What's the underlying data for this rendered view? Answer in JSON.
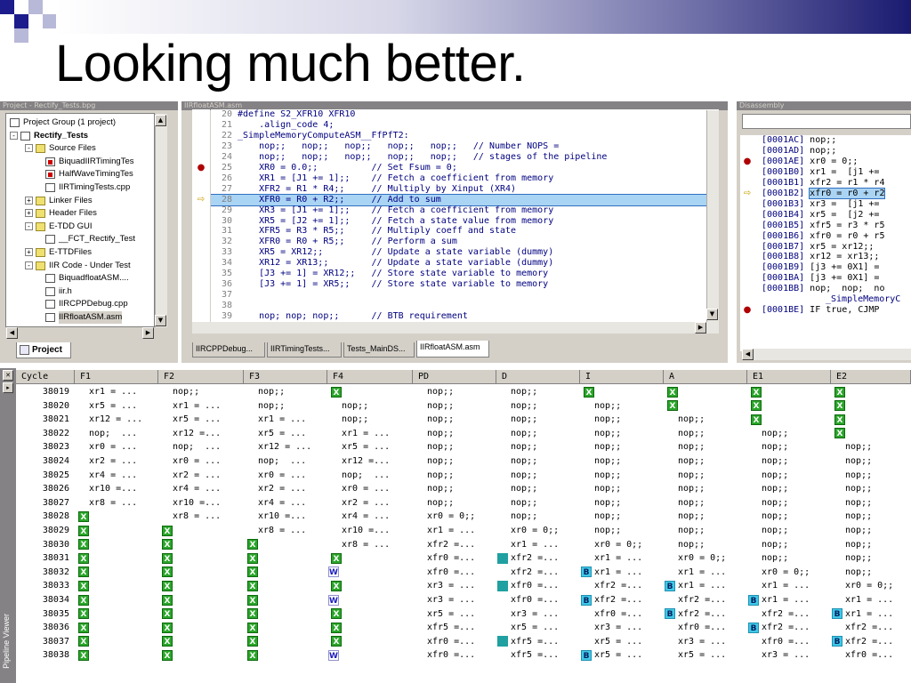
{
  "slide_title": "Looking much better.",
  "project_panel": {
    "title": "Project - Rectify_Tests.bpg",
    "tree": [
      {
        "label": "Project Group (1 project)",
        "indent": 0,
        "icon": "project-group-icon",
        "bold": false,
        "expander": ""
      },
      {
        "label": "Rectify_Tests",
        "indent": 0,
        "icon": "project-icon",
        "bold": true,
        "expander": "-"
      },
      {
        "label": "Source Files",
        "indent": 1,
        "icon": "folder-icon",
        "bold": false,
        "expander": "-"
      },
      {
        "label": "BiquadIIRTimingTes",
        "indent": 2,
        "icon": "excluded-file-icon",
        "bold": false,
        "expander": ""
      },
      {
        "label": "HalfWaveTimingTes",
        "indent": 2,
        "icon": "excluded-file-icon",
        "bold": false,
        "expander": ""
      },
      {
        "label": "IIRTimingTests.cpp",
        "indent": 2,
        "icon": "file-icon",
        "bold": false,
        "expander": ""
      },
      {
        "label": "Linker Files",
        "indent": 1,
        "icon": "folder-icon",
        "bold": false,
        "expander": "+"
      },
      {
        "label": "Header Files",
        "indent": 1,
        "icon": "folder-icon",
        "bold": false,
        "expander": "+"
      },
      {
        "label": "E-TDD GUI",
        "indent": 1,
        "icon": "folder-icon",
        "bold": false,
        "expander": "-"
      },
      {
        "label": "__FCT_Rectify_Test",
        "indent": 2,
        "icon": "file-icon",
        "bold": false,
        "expander": ""
      },
      {
        "label": "E-TTDFiles",
        "indent": 1,
        "icon": "folder-icon",
        "bold": false,
        "expander": "+"
      },
      {
        "label": "IIR Code - Under Test",
        "indent": 1,
        "icon": "folder-icon",
        "bold": false,
        "expander": "-"
      },
      {
        "label": "BiquadfloatASM....",
        "indent": 2,
        "icon": "file-icon",
        "bold": false,
        "expander": ""
      },
      {
        "label": "iir.h",
        "indent": 2,
        "icon": "file-icon",
        "bold": false,
        "expander": ""
      },
      {
        "label": "IIRCPPDebug.cpp",
        "indent": 2,
        "icon": "file-icon",
        "bold": false,
        "expander": ""
      },
      {
        "label": "IIRfloatASM.asm",
        "indent": 2,
        "icon": "file-icon",
        "bold": false,
        "expander": ""
      }
    ],
    "tab_label": "Project"
  },
  "editor": {
    "title": "IIRfloatASM.asm",
    "lines": [
      {
        "n": "20",
        "code": "#define S2_XFR10 XFR10",
        "mark": ""
      },
      {
        "n": "21",
        "code": "    .align_code 4;",
        "mark": ""
      },
      {
        "n": "22",
        "code": "_SimpleMemoryComputeASM__FfPfT2:",
        "mark": ""
      },
      {
        "n": "23",
        "code": "    nop;;   nop;;   nop;;   nop;;   nop;;   // Number NOPS =",
        "mark": ""
      },
      {
        "n": "24",
        "code": "    nop;;   nop;;   nop;;   nop;;   nop;;   // stages of the pipeline",
        "mark": ""
      },
      {
        "n": "25",
        "code": "    XR0 = 0.0;;          // Set Fsum = 0;",
        "mark": "breakpoint"
      },
      {
        "n": "26",
        "code": "    XR1 = [J1 += 1];;    // Fetch a coefficient from memory",
        "mark": ""
      },
      {
        "n": "27",
        "code": "    XFR2 = R1 * R4;;     // Multiply by Xinput (XR4)",
        "mark": ""
      },
      {
        "n": "28",
        "code": "    XFR0 = R0 + R2;;     // Add to sum",
        "mark": "current"
      },
      {
        "n": "29",
        "code": "    XR3 = [J1 += 1];;    // Fetch a coefficient from memory",
        "mark": ""
      },
      {
        "n": "30",
        "code": "    XR5 = [J2 += 1];;    // Fetch a state value from memory",
        "mark": ""
      },
      {
        "n": "31",
        "code": "    XFR5 = R3 * R5;;     // Multiply coeff and state",
        "mark": ""
      },
      {
        "n": "32",
        "code": "    XFR0 = R0 + R5;;     // Perform a sum",
        "mark": ""
      },
      {
        "n": "33",
        "code": "    XR5 = XR12;;         // Update a state variable (dummy)",
        "mark": ""
      },
      {
        "n": "34",
        "code": "    XR12 = XR13;;        // Update a state variable (dummy)",
        "mark": ""
      },
      {
        "n": "35",
        "code": "    [J3 += 1] = XR12;;   // Store state variable to memory",
        "mark": ""
      },
      {
        "n": "36",
        "code": "    [J3 += 1] = XR5;;    // Store state variable to memory",
        "mark": ""
      },
      {
        "n": "37",
        "code": "",
        "mark": ""
      },
      {
        "n": "38",
        "code": "",
        "mark": ""
      },
      {
        "n": "39",
        "code": "    nop; nop; nop;;      // BTB requirement",
        "mark": ""
      }
    ],
    "tabs": [
      "IIRCPPDebug...",
      "IIRTimingTests...",
      "Tests_MainDS...",
      "IIRfloatASM.asm"
    ],
    "active_tab": 3
  },
  "disassembly": {
    "title": "Disassembly",
    "lines": [
      {
        "addr": "[0001AC]",
        "code": "nop;;",
        "mark": ""
      },
      {
        "addr": "[0001AD]",
        "code": "nop;;",
        "mark": ""
      },
      {
        "addr": "[0001AE]",
        "code": "xr0 = 0;;",
        "mark": "breakpoint"
      },
      {
        "addr": "[0001B0]",
        "code": "xr1 =  [j1 +=",
        "mark": ""
      },
      {
        "addr": "[0001B1]",
        "code": "xfr2 = r1 * r4",
        "mark": ""
      },
      {
        "addr": "[0001B2]",
        "code": "xfr0 = r0 + r2",
        "mark": "current"
      },
      {
        "addr": "[0001B3]",
        "code": "xr3 =  [j1 +=",
        "mark": ""
      },
      {
        "addr": "[0001B4]",
        "code": "xr5 =  [j2 +=",
        "mark": ""
      },
      {
        "addr": "[0001B5]",
        "code": "xfr5 = r3 * r5",
        "mark": ""
      },
      {
        "addr": "[0001B6]",
        "code": "xfr0 = r0 + r5",
        "mark": ""
      },
      {
        "addr": "[0001B7]",
        "code": "xr5 = xr12;;",
        "mark": ""
      },
      {
        "addr": "[0001B8]",
        "code": "xr12 = xr13;;",
        "mark": ""
      },
      {
        "addr": "[0001B9]",
        "code": "[j3 += 0X1] =",
        "mark": ""
      },
      {
        "addr": "[0001BA]",
        "code": "[j3 += 0X1] =",
        "mark": ""
      },
      {
        "addr": "[0001BB]",
        "code": "nop;  nop;  no",
        "mark": ""
      },
      {
        "addr": "",
        "code": "_SimpleMemoryC",
        "mark": ""
      },
      {
        "addr": "[0001BE]",
        "code": "IF true, CJMP",
        "mark": "breakpoint"
      }
    ]
  },
  "pipeline": {
    "panel_label": "Pipeline Viewer",
    "columns": [
      "Cycle",
      "F1",
      "F2",
      "F3",
      "F4",
      "PD",
      "D",
      "I",
      "A",
      "E1",
      "E2"
    ],
    "rows": [
      {
        "cycle": "38019",
        "cells": [
          "xr1 = ...",
          "nop;;",
          "nop;;",
          "X",
          "nop;;",
          "nop;;",
          "X",
          "X",
          "X",
          "X"
        ]
      },
      {
        "cycle": "38020",
        "cells": [
          "xr5 = ...",
          "xr1 = ...",
          "nop;;",
          "nop;;",
          "nop;;",
          "nop;;",
          "nop;;",
          "X",
          "X",
          "X"
        ]
      },
      {
        "cycle": "38021",
        "cells": [
          "xr12 = ...",
          "xr5 = ...",
          "xr1 = ...",
          "nop;;",
          "nop;;",
          "nop;;",
          "nop;;",
          "nop;;",
          "X",
          "X"
        ]
      },
      {
        "cycle": "38022",
        "cells": [
          "nop;  ...",
          "xr12 =...",
          "xr5 = ...",
          "xr1 = ...",
          "nop;;",
          "nop;;",
          "nop;;",
          "nop;;",
          "nop;;",
          "X"
        ]
      },
      {
        "cycle": "38023",
        "cells": [
          "xr0 = ...",
          "nop;  ...",
          "xr12 = ...",
          "xr5 = ...",
          "nop;;",
          "nop;;",
          "nop;;",
          "nop;;",
          "nop;;",
          "nop;;"
        ]
      },
      {
        "cycle": "38024",
        "cells": [
          "xr2 = ...",
          "xr0 = ...",
          "nop;  ...",
          "xr12 =...",
          "nop;;",
          "nop;;",
          "nop;;",
          "nop;;",
          "nop;;",
          "nop;;"
        ]
      },
      {
        "cycle": "38025",
        "cells": [
          "xr4 = ...",
          "xr2 = ...",
          "xr0 = ...",
          "nop;  ...",
          "nop;;",
          "nop;;",
          "nop;;",
          "nop;;",
          "nop;;",
          "nop;;"
        ]
      },
      {
        "cycle": "38026",
        "cells": [
          "xr10 =...",
          "xr4 = ...",
          "xr2 = ...",
          "xr0 = ...",
          "nop;;",
          "nop;;",
          "nop;;",
          "nop;;",
          "nop;;",
          "nop;;"
        ]
      },
      {
        "cycle": "38027",
        "cells": [
          "xr8 = ...",
          "xr10 =...",
          "xr4 = ...",
          "xr2 = ...",
          "nop;;",
          "nop;;",
          "nop;;",
          "nop;;",
          "nop;;",
          "nop;;"
        ]
      },
      {
        "cycle": "38028",
        "cells": [
          "X",
          "xr8 = ...",
          "xr10 =...",
          "xr4 = ...",
          "xr0 = 0;;",
          "nop;;",
          "nop;;",
          "nop;;",
          "nop;;",
          "nop;;"
        ]
      },
      {
        "cycle": "38029",
        "cells": [
          "X",
          "X",
          "xr8 = ...",
          "xr10 =...",
          "xr1 = ...",
          "xr0 = 0;;",
          "nop;;",
          "nop;;",
          "nop;;",
          "nop;;"
        ]
      },
      {
        "cycle": "38030",
        "cells": [
          "X",
          "X",
          "X",
          "xr8 = ...",
          "xfr2 =...",
          "xr1 = ...",
          "xr0 = 0;;",
          "nop;;",
          "nop;;",
          "nop;;"
        ]
      },
      {
        "cycle": "38031",
        "cells": [
          "X",
          "X",
          "X",
          "X",
          "xfr0 =...",
          "S|xfr2 =...",
          "xr1 = ...",
          "xr0 = 0;;",
          "nop;;",
          "nop;;"
        ]
      },
      {
        "cycle": "38032",
        "cells": [
          "X",
          "X",
          "X",
          "W|",
          "xfr0 =...",
          "xfr2 =...",
          "B|xr1 = ...",
          "xr1 = ...",
          "xr0 = 0;;",
          "nop;;"
        ]
      },
      {
        "cycle": "38033",
        "cells": [
          "X",
          "X",
          "X",
          "X",
          "xr3 = ...",
          "S|xfr0 =...",
          "xfr2 =...",
          "B|xr1 = ...",
          "xr1 = ...",
          "xr0 = 0;;"
        ]
      },
      {
        "cycle": "38034",
        "cells": [
          "X",
          "X",
          "X",
          "W|",
          "xr3 = ...",
          "xfr0 =...",
          "B|xfr2 =...",
          "xfr2 =...",
          "B|xr1 = ...",
          "xr1 = ..."
        ]
      },
      {
        "cycle": "38035",
        "cells": [
          "X",
          "X",
          "X",
          "X",
          "xr5 = ...",
          "xr3 = ...",
          "xfr0 =...",
          "B|xfr2 =...",
          "xfr2 =...",
          "B|xr1 = ..."
        ]
      },
      {
        "cycle": "38036",
        "cells": [
          "X",
          "X",
          "X",
          "X",
          "xfr5 =...",
          "xr5 = ...",
          "xr3 = ...",
          "xfr0 =...",
          "B|xfr2 =...",
          "xfr2 =..."
        ]
      },
      {
        "cycle": "38037",
        "cells": [
          "X",
          "X",
          "X",
          "X",
          "xfr0 =...",
          "S|xfr5 =...",
          "xr5 = ...",
          "xr3 = ...",
          "xfr0 =...",
          "B|xfr2 =..."
        ]
      },
      {
        "cycle": "38038",
        "cells": [
          "X",
          "X",
          "X",
          "W|",
          "xfr0 =...",
          "xfr5 =...",
          "B|xr5 = ...",
          "xr5 = ...",
          "xr3 = ...",
          "xfr0 =..."
        ]
      }
    ]
  }
}
